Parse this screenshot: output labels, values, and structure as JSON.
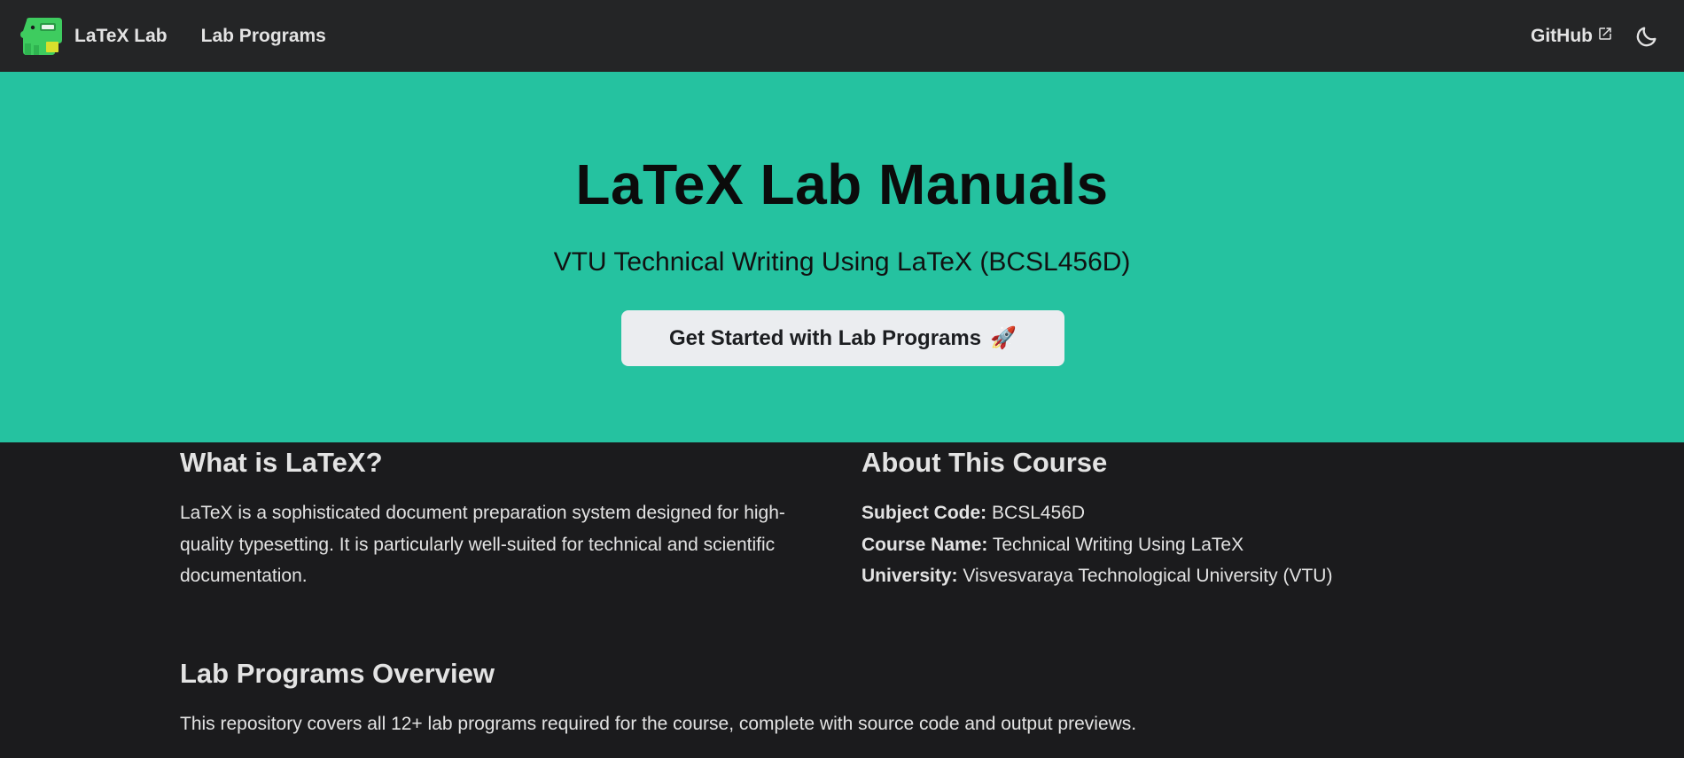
{
  "navbar": {
    "brand_title": "LaTeX Lab",
    "links": [
      "Lab Programs"
    ],
    "github_label": "GitHub",
    "icons": {
      "logo": "dinosaur-logo",
      "external": "external-link-icon",
      "theme": "moon-icon"
    }
  },
  "hero": {
    "title": "LaTeX Lab Manuals",
    "subtitle": "VTU Technical Writing Using LaTeX (BCSL456D)",
    "button_label": "Get Started with Lab Programs",
    "button_emoji": "🚀"
  },
  "what_is": {
    "heading": "What is LaTeX?",
    "text": "LaTeX is a sophisticated document preparation system designed for high-quality typesetting. It is particularly well-suited for technical and scientific documentation."
  },
  "about": {
    "heading": "About This Course",
    "items": [
      {
        "label": "Subject Code:",
        "value": "BCSL456D"
      },
      {
        "label": "Course Name:",
        "value": "Technical Writing Using LaTeX"
      },
      {
        "label": "University:",
        "value": "Visvesvaraya Technological University (VTU)"
      }
    ]
  },
  "overview": {
    "heading": "Lab Programs Overview",
    "text": "This repository covers all 12+ lab programs required for the course, complete with source code and output previews."
  },
  "colors": {
    "navbar_bg": "#242526",
    "hero_bg": "#25c2a0",
    "page_bg": "#1b1b1d",
    "text": "#e3e3e3",
    "button_bg": "#ebedf0"
  }
}
